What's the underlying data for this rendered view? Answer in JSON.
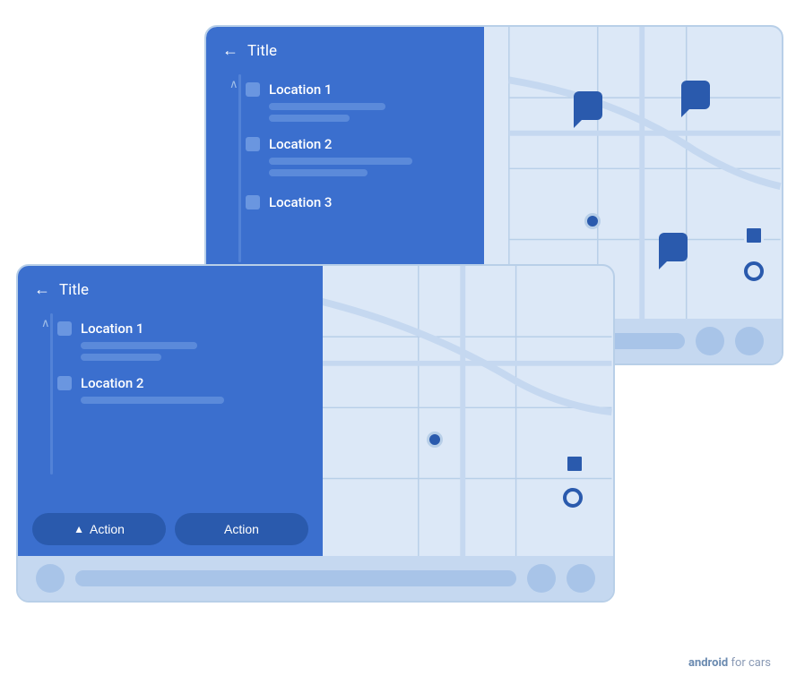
{
  "back_card": {
    "sidebar": {
      "title": "Title",
      "back_label": "←",
      "items": [
        {
          "id": 1,
          "label": "Location 1",
          "subline_widths": [
            130,
            90
          ],
          "collapsed": false
        },
        {
          "id": 2,
          "label": "Location 2",
          "subline_widths": [
            160,
            110
          ],
          "collapsed": false
        },
        {
          "id": 3,
          "label": "Location 3",
          "subline_widths": [],
          "collapsed": true
        }
      ]
    },
    "nav_bar": {
      "pill_label": ""
    }
  },
  "front_card": {
    "sidebar": {
      "title": "Title",
      "back_label": "←",
      "items": [
        {
          "id": 1,
          "label": "Location 1",
          "subline_widths": [
            130,
            90
          ],
          "collapsed": false
        },
        {
          "id": 2,
          "label": "Location 2",
          "subline_widths": [
            160
          ],
          "collapsed": false
        }
      ],
      "action_buttons": [
        {
          "label": "Action",
          "has_icon": true
        },
        {
          "label": "Action",
          "has_icon": false
        }
      ]
    },
    "nav_bar": {
      "pill_label": ""
    }
  },
  "branding": {
    "text_bold": "android",
    "text_normal": " for cars"
  }
}
